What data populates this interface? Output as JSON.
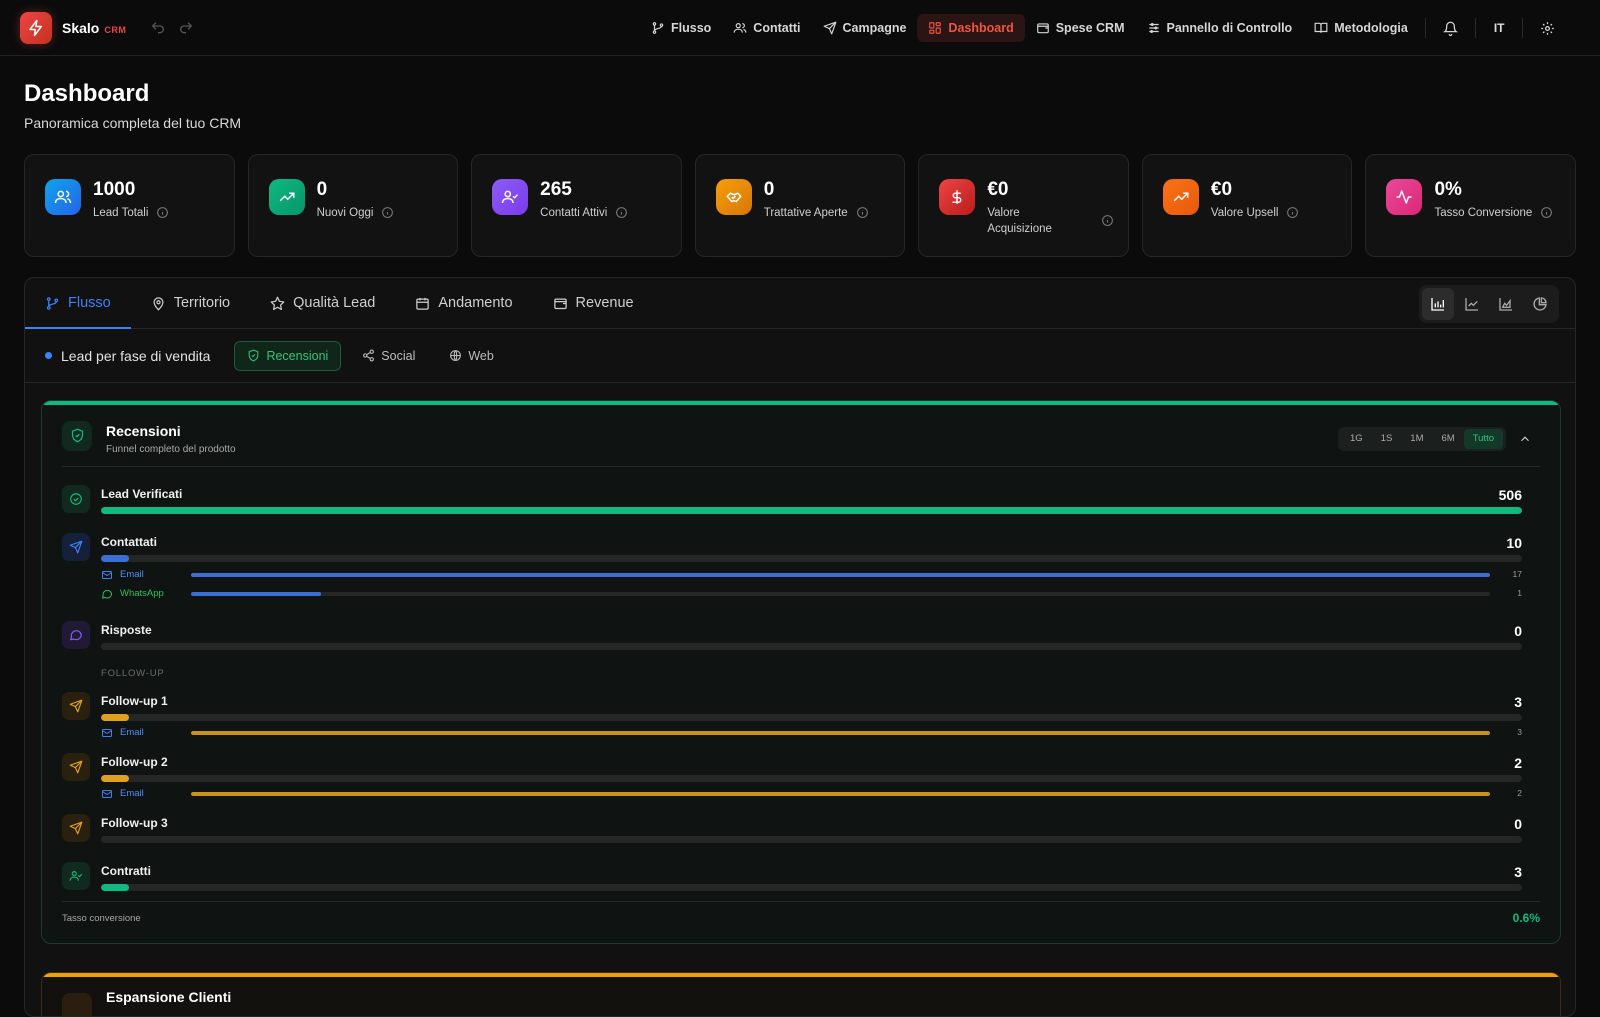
{
  "app": {
    "name": "Skalo",
    "tag": "CRM"
  },
  "nav": {
    "items": [
      {
        "label": "Flusso",
        "icon": "git-branch-icon"
      },
      {
        "label": "Contatti",
        "icon": "users-icon"
      },
      {
        "label": "Campagne",
        "icon": "send-icon"
      },
      {
        "label": "Dashboard",
        "icon": "grid-icon",
        "active": true
      },
      {
        "label": "Spese CRM",
        "icon": "wallet-icon"
      },
      {
        "label": "Pannello di Controllo",
        "icon": "sliders-icon"
      },
      {
        "label": "Metodologia",
        "icon": "book-icon"
      }
    ],
    "lang": "IT"
  },
  "page": {
    "title": "Dashboard",
    "subtitle": "Panoramica completa del tuo CRM"
  },
  "kpis": [
    {
      "value": "1000",
      "label": "Lead Totali",
      "icon": "users-icon",
      "color": "#0ea5e9"
    },
    {
      "value": "0",
      "label": "Nuovi Oggi",
      "icon": "trending-up-icon",
      "color": "#10b981"
    },
    {
      "value": "265",
      "label": "Contatti Attivi",
      "icon": "user-check-icon",
      "color": "#8b5cf6"
    },
    {
      "value": "0",
      "label": "Trattative Aperte",
      "icon": "handshake-icon",
      "color": "#f59e0b"
    },
    {
      "value": "€0",
      "label": "Valore Acquisizione",
      "icon": "dollar-icon",
      "color": "#ef4444"
    },
    {
      "value": "€0",
      "label": "Valore Upsell",
      "icon": "trending-up-icon",
      "color": "#f97316"
    },
    {
      "value": "0%",
      "label": "Tasso Conversione",
      "icon": "activity-icon",
      "color": "#ec4899"
    }
  ],
  "tabs": [
    {
      "label": "Flusso",
      "icon": "git-branch-icon",
      "active": true
    },
    {
      "label": "Territorio",
      "icon": "map-pin-icon"
    },
    {
      "label": "Qualità Lead",
      "icon": "star-icon"
    },
    {
      "label": "Andamento",
      "icon": "calendar-icon"
    },
    {
      "label": "Revenue",
      "icon": "wallet-icon"
    }
  ],
  "view_modes": [
    "bar-chart-icon",
    "line-chart-icon",
    "area-chart-icon",
    "pie-chart-icon"
  ],
  "subbar": {
    "title": "Lead per fase di vendita",
    "filters": [
      {
        "label": "Recensioni",
        "icon": "shield-check-icon",
        "active": true
      },
      {
        "label": "Social",
        "icon": "share-icon"
      },
      {
        "label": "Web",
        "icon": "globe-icon"
      }
    ]
  },
  "funnel": {
    "title": "Recensioni",
    "subtitle": "Funnel completo del prodotto",
    "periods": [
      "1G",
      "1S",
      "1M",
      "6M",
      "Tutto"
    ],
    "active_period": "Tutto",
    "followup_section": "FOLLOW-UP",
    "stages": [
      {
        "name": "Lead Verificati",
        "value": 506,
        "fraction": 1.0,
        "color": "#10b981",
        "icon": "check-circle-icon"
      },
      {
        "name": "Contattati",
        "value": 10,
        "fraction": 0.02,
        "color": "#3b6fd6",
        "icon": "send-icon",
        "channels": [
          {
            "name": "Email",
            "value": 17,
            "fraction": 1.0,
            "color": "#3b6fd6",
            "icon": "mail-icon"
          },
          {
            "name": "WhatsApp",
            "value": 1,
            "fraction": 0.1,
            "color": "#3b6fd6",
            "icon": "message-circle-icon"
          }
        ]
      },
      {
        "name": "Risposte",
        "value": 0,
        "fraction": 0,
        "color": "#8b5cf6",
        "icon": "message-square-icon"
      },
      {
        "name": "Follow-up 1",
        "value": 3,
        "fraction": 0.02,
        "color": "#e0a020",
        "icon": "send-icon",
        "channels": [
          {
            "name": "Email",
            "value": 3,
            "fraction": 1.0,
            "color": "#c9921f",
            "icon": "mail-icon"
          }
        ]
      },
      {
        "name": "Follow-up 2",
        "value": 2,
        "fraction": 0.02,
        "color": "#e0a020",
        "icon": "send-icon",
        "channels": [
          {
            "name": "Email",
            "value": 2,
            "fraction": 1.0,
            "color": "#c9921f",
            "icon": "mail-icon"
          }
        ]
      },
      {
        "name": "Follow-up 3",
        "value": 0,
        "fraction": 0,
        "color": "#e0a020",
        "icon": "send-icon"
      },
      {
        "name": "Contratti",
        "value": 3,
        "fraction": 0.02,
        "color": "#10b981",
        "icon": "user-check-icon"
      }
    ],
    "conversion_label": "Tasso conversione",
    "conversion_value": "0.6%"
  },
  "next_card": {
    "title": "Espansione Clienti"
  }
}
